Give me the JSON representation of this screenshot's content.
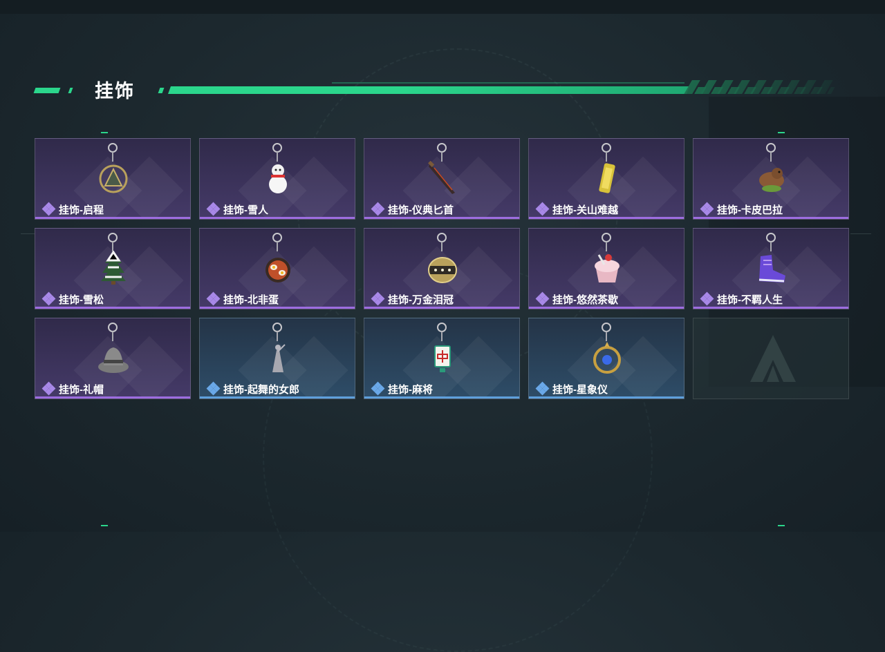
{
  "section": {
    "title": "挂饰"
  },
  "colors": {
    "accent": "#2bd68c",
    "rarity_purple": "#9d6de0",
    "rarity_blue": "#5fa0dc"
  },
  "items": [
    {
      "name": "挂饰-启程",
      "rarity": "purple",
      "icon": "medallion-charm-icon"
    },
    {
      "name": "挂饰-雪人",
      "rarity": "purple",
      "icon": "snowman-charm-icon"
    },
    {
      "name": "挂饰-仪典匕首",
      "rarity": "purple",
      "icon": "dagger-charm-icon"
    },
    {
      "name": "挂饰-关山难越",
      "rarity": "purple",
      "icon": "gold-bar-charm-icon"
    },
    {
      "name": "挂饰-卡皮巴拉",
      "rarity": "purple",
      "icon": "capybara-charm-icon"
    },
    {
      "name": "挂饰-雪松",
      "rarity": "purple",
      "icon": "pine-tree-charm-icon"
    },
    {
      "name": "挂饰-北非蛋",
      "rarity": "purple",
      "icon": "shakshuka-charm-icon"
    },
    {
      "name": "挂饰-万金泪冠",
      "rarity": "purple",
      "icon": "crown-charm-icon"
    },
    {
      "name": "挂饰-悠然茶歇",
      "rarity": "purple",
      "icon": "cupcake-charm-icon"
    },
    {
      "name": "挂饰-不羁人生",
      "rarity": "purple",
      "icon": "sneaker-charm-icon"
    },
    {
      "name": "挂饰-礼帽",
      "rarity": "purple",
      "icon": "hat-charm-icon"
    },
    {
      "name": "挂饰-起舞的女郎",
      "rarity": "blue",
      "icon": "dancer-charm-icon"
    },
    {
      "name": "挂饰-麻将",
      "rarity": "blue",
      "icon": "mahjong-charm-icon"
    },
    {
      "name": "挂饰-星象仪",
      "rarity": "blue",
      "icon": "astrolabe-charm-icon"
    }
  ],
  "empty_slot": {
    "icon": "game-logo-icon"
  }
}
